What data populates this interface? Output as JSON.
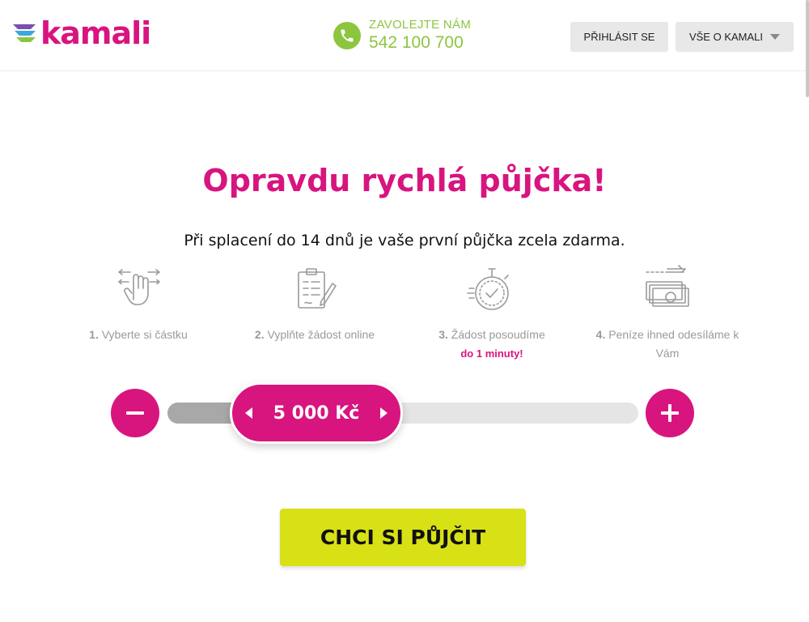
{
  "brand": {
    "name": "kamali",
    "accent": "#d8147f",
    "green": "#8cc63f",
    "cta_color": "#d7e116"
  },
  "header": {
    "phone_label": "ZAVOLEJTE NÁM",
    "phone_number": "542 100 700",
    "login_label": "PŘIHLÁSIT SE",
    "about_label": "VŠE O KAMALI"
  },
  "hero": {
    "title": "Opravdu rychlá půjčka!",
    "subtitle": "Při splacení do 14 dnů je vaše první půjčka zcela zdarma."
  },
  "steps": [
    {
      "num": "1.",
      "text": "Vyberte si částku",
      "icon": "hand-swipe-icon"
    },
    {
      "num": "2.",
      "text": "Vyplňte žádost online",
      "icon": "clipboard-form-icon"
    },
    {
      "num": "3.",
      "text": "Žádost posoudíme",
      "highlight": "do 1 minuty!",
      "icon": "stopwatch-icon"
    },
    {
      "num": "4.",
      "text": "Peníze ihned odesíláme k Vám",
      "icon": "money-transfer-icon"
    }
  ],
  "slider": {
    "value_label": "5 000 Kč",
    "fill_fraction": 0.14
  },
  "cta": {
    "label": "CHCI SI PŮJČIT"
  }
}
